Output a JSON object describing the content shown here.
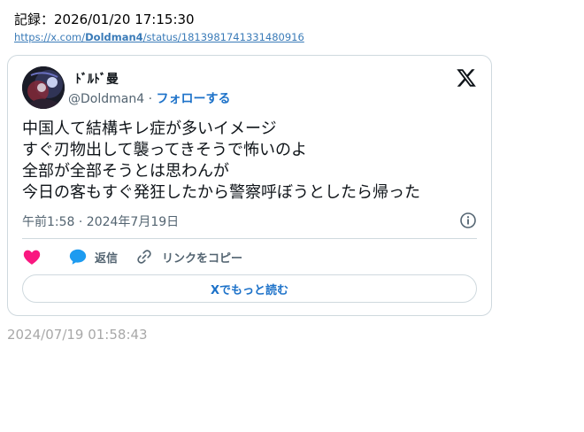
{
  "header": {
    "record_label": "記録：2026/01/20 17:15:30",
    "link_prefix": "https://x.com/",
    "link_user": "Doldman4",
    "link_suffix": "/status/1813981741331480916"
  },
  "tweet": {
    "display_name": "ﾄﾞﾙﾄﾞ曼",
    "handle": "@Doldman4",
    "separator": " · ",
    "follow_label": "フォローする",
    "lines": [
      "中国人て結構キレ症が多いイメージ",
      "すぐ刃物出して襲ってきそうで怖いのよ",
      "全部が全部そうとは思わんが",
      "今日の客もすぐ発狂したから警察呼ぼうとしたら帰った"
    ],
    "time": "午前1:58 · 2024年7月19日",
    "reply_label": "返信",
    "copy_link_label": "リンクをコピー",
    "read_more_label": "Xでもっと読む"
  },
  "footer": {
    "timestamp": "2024/07/19 01:58:43"
  },
  "colors": {
    "heart": "#f91880",
    "reply": "#1d9bf0",
    "link": "#1d72c9",
    "muted": "#536471",
    "border": "#cfd9de"
  }
}
